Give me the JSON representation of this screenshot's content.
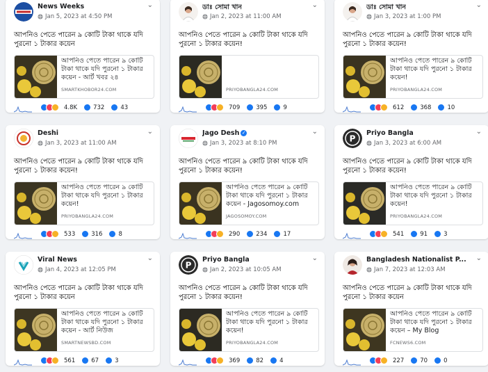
{
  "posts": [
    {
      "author": "News Weeks",
      "date": "Jan 5, 2023 at 4:50 PM",
      "text": "আপনিও পেতে পারেন ৯ কোটি টাকা থাকে যদি পুরনো ১ টাকার কয়েন",
      "link_title": "আপনিও পেতে পারেন ৯ কোটি টাকা থাকে যদি পুরনো ১ টাকার কয়েন - আর্ট খবর ২৪",
      "domain": "SMARTKHOBOR24.COM",
      "reactions": "4.8K",
      "comments": "732",
      "shares": "43",
      "avatar": "newsweeks"
    },
    {
      "author": "ডাঃ সোমা খান",
      "date": "Jan 2, 2023 at 11:00 AM",
      "text": "আপনিও পেতে পারেন ৯ কোটি টাকা থাকে যদি পুরনো ১ টাকার কয়েন!",
      "link_title": "",
      "domain": "PRIYOBANGLA24.COM",
      "reactions": "709",
      "comments": "395",
      "shares": "9",
      "avatar": "doctor"
    },
    {
      "author": "ডাঃ সোমা খান",
      "date": "Jan 3, 2023 at 1:00 PM",
      "text": "আপনিও পেতে পারেন ৯ কোটি টাকা থাকে যদি পুরনো ১ টাকার কয়েন!",
      "link_title": "আপনিও পেতে পারেন ৯ কোটি টাকা থাকে যদি পুরনো ১ টাকার কয়েন!",
      "domain": "PRIYOBANGLA24.COM",
      "reactions": "612",
      "comments": "368",
      "shares": "10",
      "avatar": "doctor"
    },
    {
      "author": "Deshi",
      "date": "Jan 3, 2023 at 11:00 AM",
      "text": "আপনিও পেতে পারেন ৯ কোটি টাকা থাকে যদি পুরনো ১ টাকার কয়েন!",
      "link_title": "আপনিও পেতে পারেন ৯ কোটি টাকা থাকে যদি পুরনো ১ টাকার কয়েন!",
      "domain": "PRIYOBANGLA24.COM",
      "reactions": "533",
      "comments": "316",
      "shares": "8",
      "avatar": "deshi"
    },
    {
      "author": "Jago Desh",
      "date": "Jan 3, 2023 at 8:10 PM",
      "text": "আপনিও পেতে পারেন ৯ কোটি টাকা থাকে যদি পুরনো ১ টাকার কয়েন!",
      "link_title": "আপনিও পেতে পারেন ৯ কোটি টাকা থাকে যদি পুরনো ১ টাকার কয়েন - Jagosomoy.com",
      "domain": "JAGOSOMOY.COM",
      "reactions": "290",
      "comments": "234",
      "shares": "17",
      "avatar": "jagodesh",
      "verified": true
    },
    {
      "author": "Priyo Bangla",
      "date": "Jan 3, 2023 at 6:00 AM",
      "text": "আপনিও পেতে পারেন ৯ কোটি টাকা থাকে যদি পুরনো ১ টাকার কয়েন!",
      "link_title": "আপনিও পেতে পারেন ৯ কোটি টাকা থাকে যদি পুরনো ১ টাকার কয়েন!",
      "domain": "PRIYOBANGLA24.COM",
      "reactions": "541",
      "comments": "91",
      "shares": "3",
      "avatar": "priyo"
    },
    {
      "author": "Viral News",
      "date": "Jan 4, 2023 at 12:05 PM",
      "text": "আপনিও পেতে পারেন ৯ কোটি টাকা থাকে যদি পুরনো ১ টাকার কয়েন",
      "link_title": "আপনিও পেতে পারেন ৯ কোটি টাকা থাকে যদি পুরনো ১ টাকার কয়েন - আর্ট নিউজ",
      "domain": "SMARTNEWSBD.COM",
      "reactions": "561",
      "comments": "67",
      "shares": "3",
      "avatar": "viral"
    },
    {
      "author": "Priyo Bangla",
      "date": "Jan 2, 2023 at 10:05 AM",
      "text": "আপনিও পেতে পারেন ৯ কোটি টাকা থাকে যদি পুরনো ১ টাকার কয়েন!",
      "link_title": "আপনিও পেতে পারেন ৯ কোটি টাকা থাকে যদি পুরনো ১ টাকার কয়েন!",
      "domain": "PRIYOBANGLA24.COM",
      "reactions": "369",
      "comments": "82",
      "shares": "4",
      "avatar": "priyo"
    },
    {
      "author": "Bangladesh Nationalist P...",
      "date": "Jan 7, 2023 at 12:03 AM",
      "text": "আপনিও পেতে পারেন ৯ কোটি টাকা থাকে যদি পুরনো ১ টাকার কয়েন",
      "link_title": "আপনিও পেতে পারেন ৯ কোটি টাকা থাকে যদি পুরনো ১ টাকার কয়েন – My Blog",
      "domain": "FCNEWS6.COM",
      "reactions": "227",
      "comments": "70",
      "shares": "0",
      "avatar": "bnp"
    }
  ],
  "colors": {
    "like": "#1877f2",
    "love": "#f33e58",
    "haha": "#f7b125",
    "comment": "#1877f2",
    "share": "#1877f2"
  },
  "icons": {
    "globe": "globe-icon",
    "chevron": "chevron-down-icon",
    "comment": "comment-icon",
    "share": "share-icon"
  }
}
